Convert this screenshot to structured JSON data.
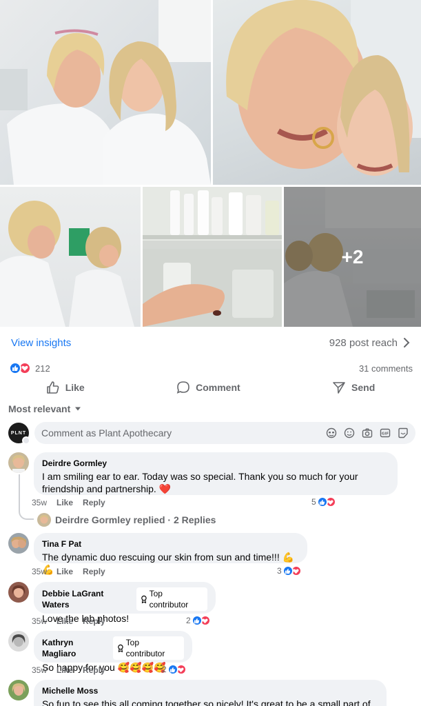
{
  "post": {
    "more_photos": "+2",
    "insights_label": "View insights",
    "reach_text": "928 post reach",
    "reaction_count": "212",
    "comments_count": "31 comments",
    "reaction_colors": {
      "like": "#1877f2",
      "love": "#f33e58"
    }
  },
  "actions": {
    "like": "Like",
    "comment": "Comment",
    "send": "Send"
  },
  "sort": {
    "label": "Most relevant"
  },
  "composer": {
    "avatar_text": "PLNT",
    "placeholder": "Comment as Plant Apothecary",
    "icons": [
      "avatar-sticker-icon",
      "emoji-icon",
      "camera-icon",
      "gif-icon",
      "sticker-icon"
    ]
  },
  "comments": [
    {
      "name": "Deirdre Gormley",
      "text": "I am smiling ear to ear. Today was so special. Thank you so much for your friendship and partnership. ❤️",
      "time": "35w",
      "like": "Like",
      "reply": "Reply",
      "reactions": "5"
    },
    {
      "name": "Tina F Pat",
      "text": "The dynamic duo rescuing our skin from sun and time!!! 💪💪",
      "time": "35w",
      "like": "Like",
      "reply": "Reply",
      "reactions": "3"
    },
    {
      "name": "Debbie LaGrant Waters",
      "badge": "Top contributor",
      "text": "Love the lab photos!",
      "time": "35w",
      "like": "Like",
      "reply": "Reply",
      "reactions": "2"
    },
    {
      "name": "Kathryn Magliaro",
      "badge": "Top contributor",
      "text": "So happy for you 🥰🥰🥰🥰",
      "time": "35w",
      "like": "Like",
      "reply": "Reply",
      "reactions": "2"
    },
    {
      "name": "Michelle Moss",
      "text": "So fun to see this all coming together so nicely! It's great to be a small part of it!"
    }
  ],
  "replies": {
    "text": "Deirdre Gormley replied · 2 Replies"
  }
}
